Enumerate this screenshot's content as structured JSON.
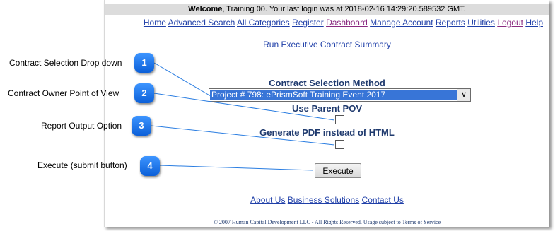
{
  "welcome": {
    "bold": "Welcome",
    "rest": ", Training 00. Your last login was at 2018-02-16 14:29:20.589532 GMT."
  },
  "nav": [
    "Home",
    "Advanced Search",
    "All Categories",
    "Register",
    "Dashboard",
    "Manage Account",
    "Reports",
    "Utilities",
    "Logout",
    "Help"
  ],
  "page_title": "Run Executive Contract Summary",
  "form": {
    "contract_method_label": "Contract Selection Method",
    "contract_selected": "Project # 798: ePrismSoft Training Event 2017",
    "parent_pov_label": "Use Parent POV",
    "pdf_label": "Generate PDF instead of HTML",
    "execute_label": "Execute"
  },
  "footer": {
    "links": [
      "About Us",
      "Business Solutions",
      "Contact Us"
    ],
    "copyright": "© 2007 Human Capital Development LLC - All Rights Reserved. Usage subject to Terms of Service"
  },
  "callouts": [
    {
      "number": "1",
      "text": "Contract Selection Drop down"
    },
    {
      "number": "2",
      "text": "Contract Owner Point of View"
    },
    {
      "number": "3",
      "text": "Report Output Option"
    },
    {
      "number": "4",
      "text": "Execute (submit button)"
    }
  ],
  "colors": {
    "link": "#1f3fa8",
    "visited_link": "#8a2a80",
    "badge": "#1a73e8",
    "selection": "#3875d7"
  }
}
